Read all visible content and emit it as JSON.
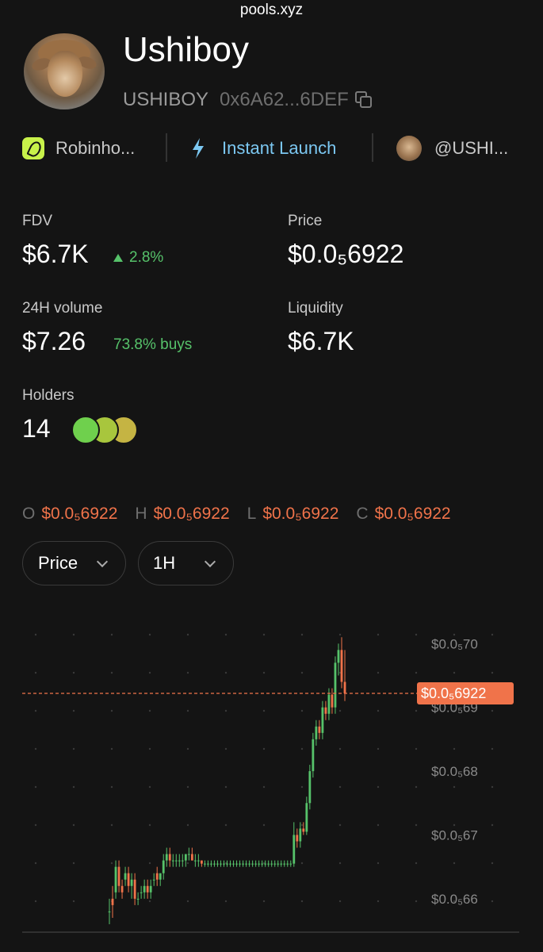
{
  "browser": {
    "url": "pools.xyz"
  },
  "token": {
    "name": "Ushiboy",
    "symbol": "USHIBOY",
    "address": "0x6A62...6DEF"
  },
  "links": {
    "platform": "Robinho...",
    "launch": "Instant Launch",
    "social": "@USHI..."
  },
  "stats": {
    "fdv": {
      "label": "FDV",
      "value": "$6.7K",
      "change": "2.8%"
    },
    "price": {
      "label": "Price",
      "value": "$0.0₅6922"
    },
    "volume": {
      "label": "24H volume",
      "value": "$7.26",
      "buys": "73.8% buys"
    },
    "liquidity": {
      "label": "Liquidity",
      "value": "$6.7K"
    },
    "holders": {
      "label": "Holders",
      "value": "14"
    }
  },
  "ohlc": {
    "o_label": "O",
    "o": "$0.0₅6922",
    "h_label": "H",
    "h": "$0.0₅6922",
    "l_label": "L",
    "l": "$0.0₅6922",
    "c_label": "C",
    "c": "$0.0₅6922"
  },
  "controls": {
    "metric": "Price",
    "interval": "1H"
  },
  "colors": {
    "up": "#56c26a",
    "down": "#f0734a",
    "accent_blue": "#7cc8f2",
    "robinhood": "#c8f24a"
  },
  "icons": [
    "robinhood-icon",
    "bolt-icon",
    "copy-icon",
    "chevron-down-icon"
  ],
  "chart_data": {
    "type": "candlestick",
    "ylim": [
      6.56,
      7.07
    ],
    "y_ticks": [
      6.6,
      6.7,
      6.8,
      6.9,
      7.0
    ],
    "y_tick_labels": [
      "$0.0₅66",
      "$0.0₅67",
      "$0.0₅68",
      "$0.0₅69",
      "$0.0₅70"
    ],
    "current_price": 6.922,
    "current_price_label": "$0.0₅6922",
    "candles": [
      [
        6.58,
        6.6,
        6.56,
        6.58
      ],
      [
        6.6,
        6.62,
        6.57,
        6.59
      ],
      [
        6.61,
        6.66,
        6.6,
        6.65
      ],
      [
        6.65,
        6.66,
        6.61,
        6.62
      ],
      [
        6.62,
        6.63,
        6.6,
        6.61
      ],
      [
        6.63,
        6.65,
        6.62,
        6.64
      ],
      [
        6.64,
        6.65,
        6.61,
        6.62
      ],
      [
        6.62,
        6.64,
        6.6,
        6.63
      ],
      [
        6.63,
        6.64,
        6.59,
        6.6
      ],
      [
        6.6,
        6.61,
        6.59,
        6.6
      ],
      [
        6.61,
        6.62,
        6.6,
        6.61
      ],
      [
        6.61,
        6.63,
        6.6,
        6.62
      ],
      [
        6.62,
        6.63,
        6.6,
        6.61
      ],
      [
        6.61,
        6.63,
        6.6,
        6.62
      ],
      [
        6.63,
        6.64,
        6.62,
        6.63
      ],
      [
        6.64,
        6.65,
        6.62,
        6.63
      ],
      [
        6.63,
        6.64,
        6.62,
        6.64
      ],
      [
        6.64,
        6.67,
        6.63,
        6.66
      ],
      [
        6.66,
        6.68,
        6.65,
        6.67
      ],
      [
        6.67,
        6.68,
        6.65,
        6.66
      ],
      [
        6.66,
        6.67,
        6.65,
        6.66
      ],
      [
        6.66,
        6.67,
        6.65,
        6.66
      ],
      [
        6.66,
        6.67,
        6.65,
        6.66
      ],
      [
        6.66,
        6.67,
        6.65,
        6.66
      ],
      [
        6.66,
        6.67,
        6.65,
        6.67
      ],
      [
        6.67,
        6.68,
        6.66,
        6.67
      ],
      [
        6.67,
        6.68,
        6.66,
        6.66
      ],
      [
        6.66,
        6.67,
        6.65,
        6.66
      ],
      [
        6.66,
        6.67,
        6.65,
        6.66
      ],
      [
        6.66,
        6.66,
        6.65,
        6.655
      ],
      [
        6.655,
        6.66,
        6.65,
        6.655
      ],
      [
        6.655,
        6.66,
        6.65,
        6.655
      ],
      [
        6.655,
        6.66,
        6.65,
        6.655
      ],
      [
        6.655,
        6.66,
        6.65,
        6.655
      ],
      [
        6.655,
        6.66,
        6.65,
        6.655
      ],
      [
        6.655,
        6.66,
        6.65,
        6.655
      ],
      [
        6.655,
        6.66,
        6.65,
        6.655
      ],
      [
        6.655,
        6.66,
        6.65,
        6.655
      ],
      [
        6.655,
        6.66,
        6.65,
        6.655
      ],
      [
        6.655,
        6.66,
        6.65,
        6.655
      ],
      [
        6.655,
        6.66,
        6.65,
        6.655
      ],
      [
        6.655,
        6.66,
        6.65,
        6.655
      ],
      [
        6.655,
        6.66,
        6.65,
        6.655
      ],
      [
        6.655,
        6.66,
        6.65,
        6.655
      ],
      [
        6.655,
        6.66,
        6.65,
        6.655
      ],
      [
        6.655,
        6.66,
        6.65,
        6.655
      ],
      [
        6.655,
        6.66,
        6.65,
        6.655
      ],
      [
        6.655,
        6.66,
        6.65,
        6.655
      ],
      [
        6.655,
        6.66,
        6.65,
        6.655
      ],
      [
        6.655,
        6.66,
        6.65,
        6.655
      ],
      [
        6.655,
        6.66,
        6.65,
        6.655
      ],
      [
        6.655,
        6.66,
        6.65,
        6.655
      ],
      [
        6.655,
        6.66,
        6.65,
        6.655
      ],
      [
        6.655,
        6.66,
        6.65,
        6.655
      ],
      [
        6.655,
        6.66,
        6.65,
        6.655
      ],
      [
        6.655,
        6.66,
        6.65,
        6.655
      ],
      [
        6.655,
        6.66,
        6.65,
        6.655
      ],
      [
        6.655,
        6.66,
        6.65,
        6.655
      ],
      [
        6.655,
        6.72,
        6.65,
        6.7
      ],
      [
        6.7,
        6.71,
        6.68,
        6.69
      ],
      [
        6.69,
        6.72,
        6.68,
        6.71
      ],
      [
        6.71,
        6.72,
        6.7,
        6.705
      ],
      [
        6.705,
        6.76,
        6.7,
        6.75
      ],
      [
        6.75,
        6.81,
        6.74,
        6.8
      ],
      [
        6.8,
        6.86,
        6.79,
        6.85
      ],
      [
        6.85,
        6.88,
        6.84,
        6.87
      ],
      [
        6.87,
        6.88,
        6.85,
        6.86
      ],
      [
        6.86,
        6.91,
        6.85,
        6.9
      ],
      [
        6.9,
        6.91,
        6.88,
        6.89
      ],
      [
        6.89,
        6.93,
        6.88,
        6.92
      ],
      [
        6.92,
        6.93,
        6.89,
        6.9
      ],
      [
        6.9,
        6.98,
        6.89,
        6.97
      ],
      [
        6.97,
        7.0,
        6.95,
        6.99
      ],
      [
        6.99,
        7.01,
        6.93,
        6.94
      ],
      [
        6.94,
        6.99,
        6.91,
        6.922
      ]
    ]
  }
}
